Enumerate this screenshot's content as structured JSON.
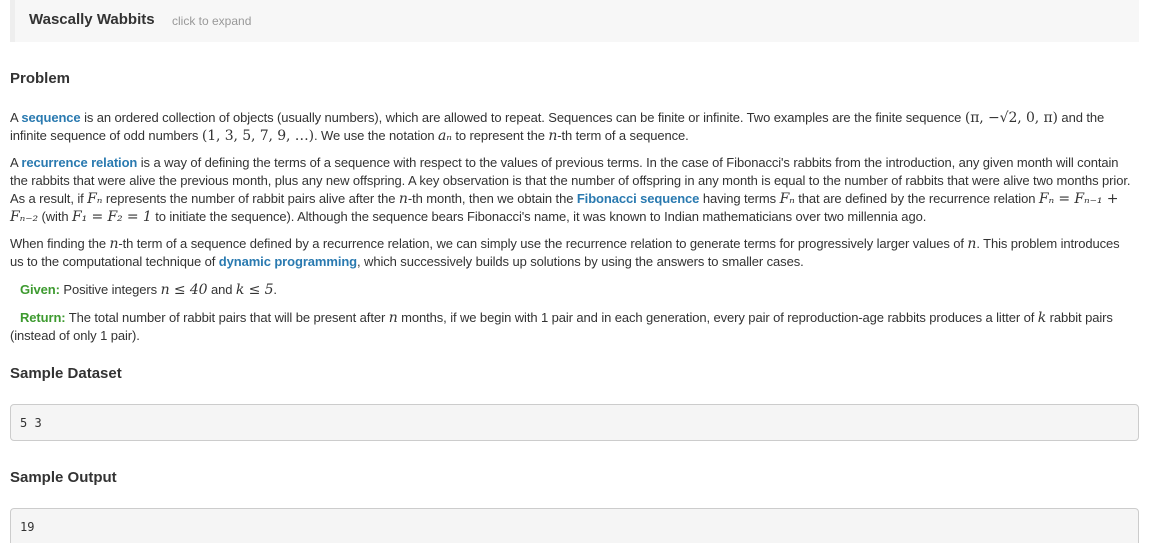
{
  "intro": {
    "title": "Wascally Wabbits",
    "hint": "click to expand"
  },
  "problem": {
    "heading": "Problem",
    "p1": {
      "t1": "A ",
      "link": "sequence",
      "t2": " is an ordered collection of objects (usually numbers), which are allowed to repeat. Sequences can be finite or infinite. Two examples are the finite sequence ",
      "m1": "(π, −√2, 0, π)",
      "t3": " and the infinite sequence of odd numbers ",
      "m2": "(1, 3, 5, 7, 9, …)",
      "t4": ". We use the notation ",
      "m3": "aₙ",
      "t5": " to represent the ",
      "m4": "n",
      "t6": "-th term of a sequence."
    },
    "p2": {
      "t1": "A ",
      "link1": "recurrence relation",
      "t2": " is a way of defining the terms of a sequence with respect to the values of previous terms. In the case of Fibonacci's rabbits from the introduction, any given month will contain the rabbits that were alive the previous month, plus any new offspring. A key observation is that the number of offspring in any month is equal to the number of rabbits that were alive two months prior. As a result, if ",
      "m1": "Fₙ",
      "t3": " represents the number of rabbit pairs alive after the ",
      "m2": "n",
      "t4": "-th month, then we obtain the ",
      "link2": "Fibonacci sequence",
      "t5": " having terms ",
      "m3": "Fₙ",
      "t6": " that are defined by the recurrence relation ",
      "m4": "Fₙ = Fₙ₋₁ + Fₙ₋₂",
      "t7": " (with ",
      "m5": "F₁ = F₂ = 1",
      "t8": " to initiate the sequence). Although the sequence bears Fibonacci's name, it was known to Indian mathematicians over two millennia ago."
    },
    "p3": {
      "t1": "When finding the ",
      "m1": "n",
      "t2": "-th term of a sequence defined by a recurrence relation, we can simply use the recurrence relation to generate terms for progressively larger values of ",
      "m2": "n",
      "t3": ". This problem introduces us to the computational technique of ",
      "link": "dynamic programming",
      "t4": ", which successively builds up solutions by using the answers to smaller cases."
    },
    "given": {
      "label": "Given:",
      "t1": " Positive integers ",
      "m1": "n ≤ 40",
      "t2": " and ",
      "m2": "k ≤ 5",
      "t3": "."
    },
    "return": {
      "label": "Return:",
      "t1": " The total number of rabbit pairs that will be present after ",
      "m1": "n",
      "t2": " months, if we begin with 1 pair and in each generation, every pair of reproduction-age rabbits produces a litter of ",
      "m2": "k",
      "t3": " rabbit pairs (instead of only 1 pair)."
    }
  },
  "sample_dataset": {
    "heading": "Sample Dataset",
    "value": "5 3"
  },
  "sample_output": {
    "heading": "Sample Output",
    "value": "19"
  }
}
